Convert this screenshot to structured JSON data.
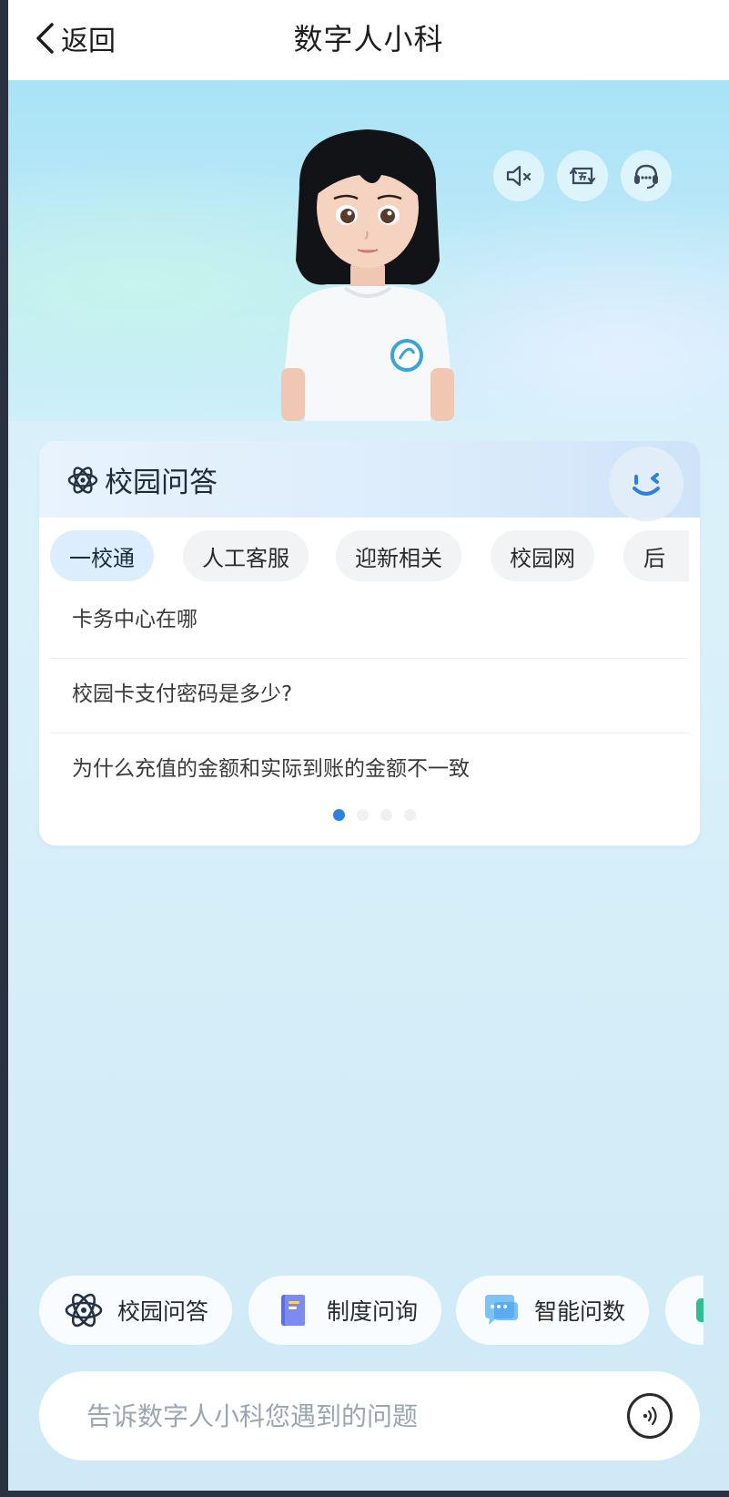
{
  "header": {
    "back_label": "返回",
    "title": "数字人小科"
  },
  "hero": {
    "controls": [
      {
        "name": "mute",
        "icon": "speaker-mute-icon"
      },
      {
        "name": "switch",
        "icon": "switch-icon"
      },
      {
        "name": "agent",
        "icon": "customer-service-icon"
      }
    ]
  },
  "card": {
    "icon": "atom-icon",
    "title": "校园问答",
    "tabs": [
      {
        "label": "一校通",
        "active": true
      },
      {
        "label": "人工客服",
        "active": false
      },
      {
        "label": "迎新相关",
        "active": false
      },
      {
        "label": "校园网",
        "active": false
      },
      {
        "label": "后",
        "active": false
      }
    ],
    "questions": [
      "卡务中心在哪",
      "校园卡支付密码是多少?",
      "为什么充值的金额和实际到账的金额不一致"
    ],
    "pager": {
      "total": 4,
      "current": 1
    }
  },
  "quick_actions": [
    {
      "label": "校园问答",
      "icon": "atom-icon"
    },
    {
      "label": "制度问询",
      "icon": "book-icon"
    },
    {
      "label": "智能问数",
      "icon": "chat-bubble-icon"
    },
    {
      "label": "",
      "icon": "green-icon"
    }
  ],
  "input": {
    "placeholder": "告诉数字人小科您遇到的问题",
    "value": ""
  },
  "colors": {
    "accent": "#2f7fe0",
    "active_tab": "#dceefd",
    "hero_bg": "#a9e3f6"
  }
}
